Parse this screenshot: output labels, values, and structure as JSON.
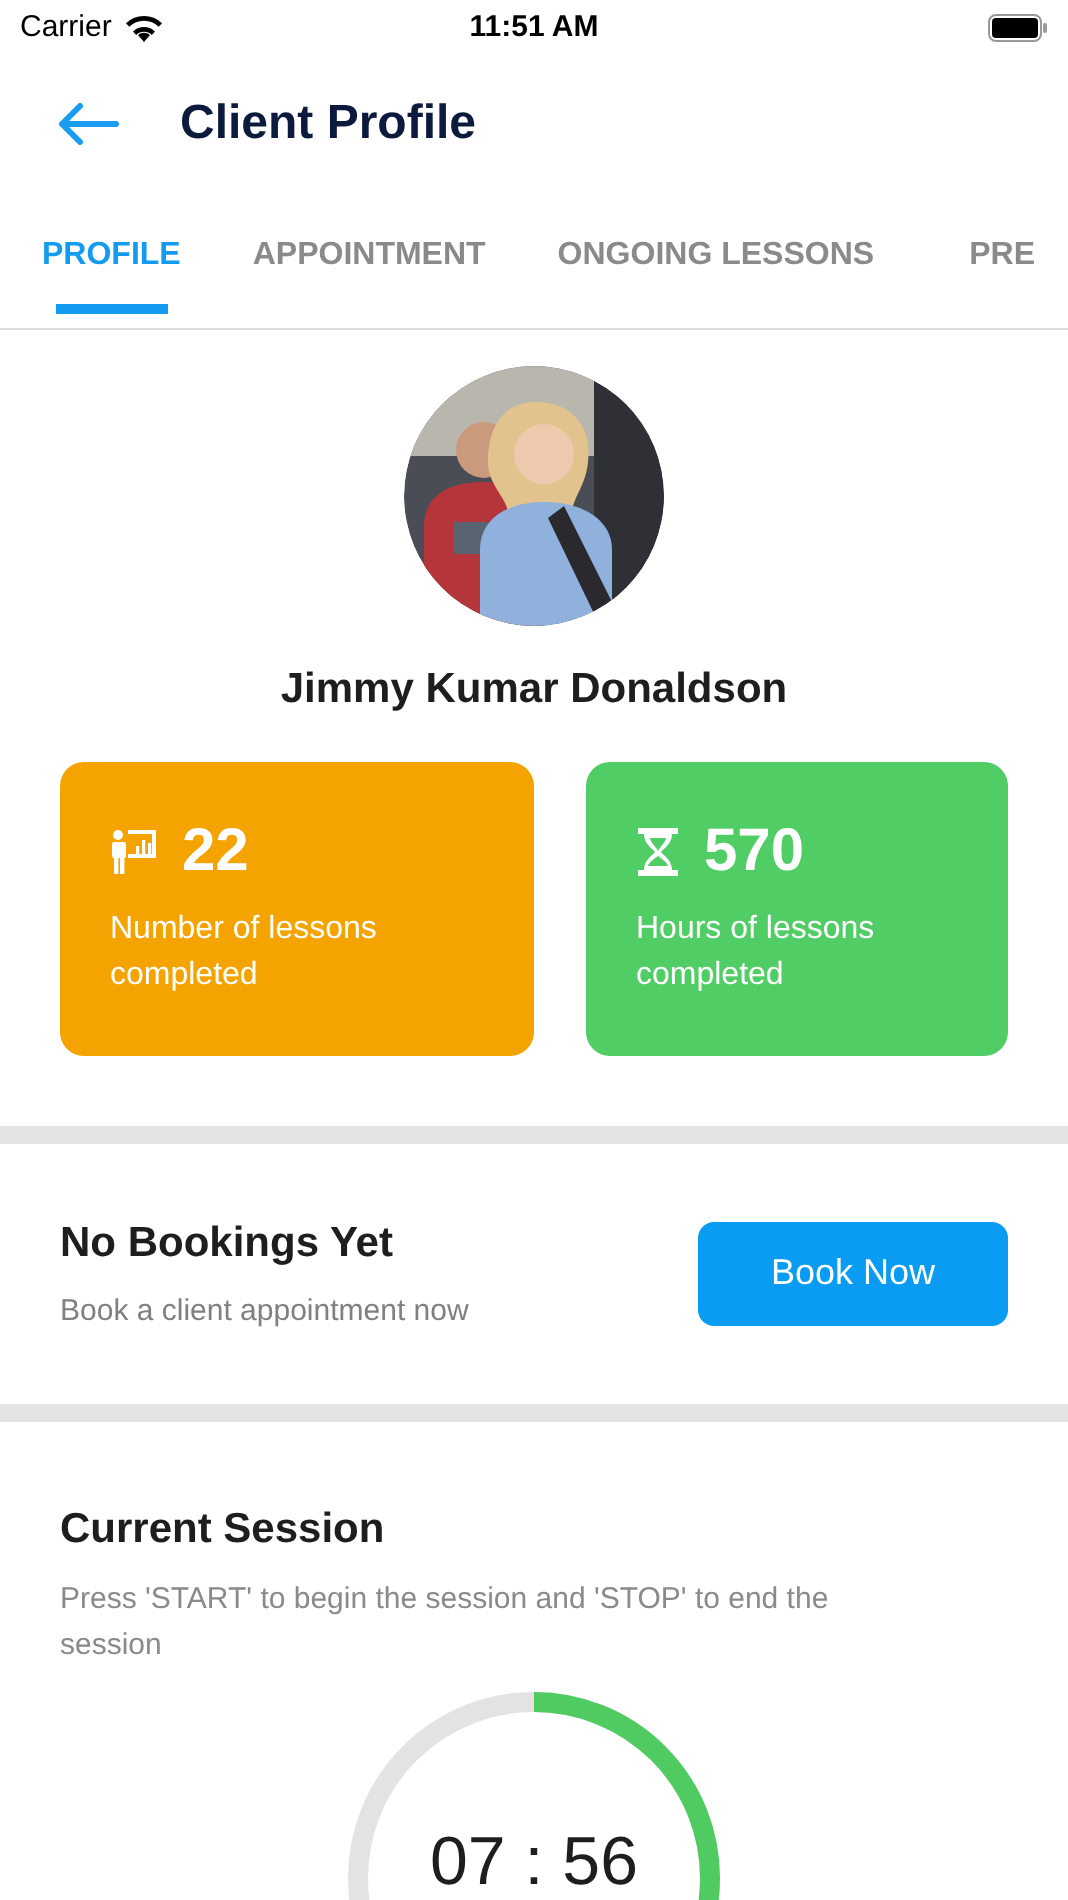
{
  "status_bar": {
    "carrier": "Carrier",
    "time": "11:51 AM"
  },
  "header": {
    "title": "Client Profile"
  },
  "tabs": [
    {
      "label": "PROFILE",
      "selected": true
    },
    {
      "label": "APPOINTMENT",
      "selected": false
    },
    {
      "label": "ONGOING LESSONS",
      "selected": false
    },
    {
      "label": "PRE",
      "selected": false
    }
  ],
  "profile": {
    "name": "Jimmy Kumar Donaldson"
  },
  "stats": [
    {
      "kind": "lessons",
      "value": "22",
      "label": "Number of lessons completed",
      "color": "#f4a300"
    },
    {
      "kind": "hours",
      "value": "570",
      "label": "Hours of lessons completed",
      "color": "#51cd65"
    }
  ],
  "bookings": {
    "title": "No Bookings Yet",
    "subtitle": "Book a client appointment now",
    "button": "Book Now"
  },
  "session": {
    "title": "Current Session",
    "description": "Press 'START' to begin the session and 'STOP' to end the session",
    "timer": "07 : 56"
  }
}
